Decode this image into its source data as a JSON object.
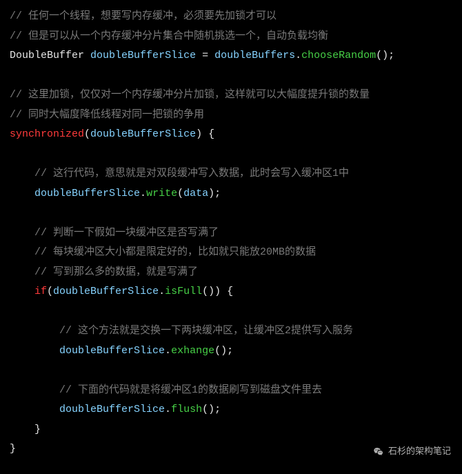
{
  "code": {
    "lines": [
      {
        "type": "comment",
        "text": "// 任何一个线程，想要写内存缓冲，必须要先加锁才可以"
      },
      {
        "type": "comment",
        "text": "// 但是可以从一个内存缓冲分片集合中随机挑选一个，自动负载均衡"
      },
      {
        "type": "decl",
        "typeName": "DoubleBuffer",
        "varName": "doubleBufferSlice",
        "eq": " = ",
        "rhsObj": "doubleBuffers",
        "dot": ".",
        "rhsMethod": "chooseRandom",
        "call": "();"
      },
      {
        "type": "blank"
      },
      {
        "type": "comment",
        "text": "// 这里加锁，仅仅对一个内存缓冲分片加锁，这样就可以大幅度提升锁的数量"
      },
      {
        "type": "comment",
        "text": "// 同时大幅度降低线程对同一把锁的争用"
      },
      {
        "type": "sync",
        "kw": "synchronized",
        "open": "(",
        "arg": "doubleBufferSlice",
        "close": ") {"
      },
      {
        "type": "blank"
      },
      {
        "type": "comment",
        "indent": "    ",
        "text": "// 这行代码，意思就是对双段缓冲写入数据，此时会写入缓冲区1中"
      },
      {
        "type": "call",
        "indent": "    ",
        "obj": "doubleBufferSlice",
        "dot": ".",
        "method": "write",
        "open": "(",
        "arg": "data",
        "close": ");"
      },
      {
        "type": "blank"
      },
      {
        "type": "comment",
        "indent": "    ",
        "text": "// 判断一下假如一块缓冲区是否写满了"
      },
      {
        "type": "comment",
        "indent": "    ",
        "text": "// 每块缓冲区大小都是限定好的，比如就只能放20MB的数据"
      },
      {
        "type": "comment",
        "indent": "    ",
        "text": "// 写到那么多的数据，就是写满了"
      },
      {
        "type": "if",
        "indent": "    ",
        "kw": "if",
        "open": "(",
        "obj": "doubleBufferSlice",
        "dot": ".",
        "method": "isFull",
        "call": "()",
        "close": ") {"
      },
      {
        "type": "blank"
      },
      {
        "type": "comment",
        "indent": "        ",
        "text": "// 这个方法就是交换一下两块缓冲区，让缓冲区2提供写入服务"
      },
      {
        "type": "call",
        "indent": "        ",
        "obj": "doubleBufferSlice",
        "dot": ".",
        "method": "exhange",
        "open": "(",
        "arg": "",
        "close": ");"
      },
      {
        "type": "blank"
      },
      {
        "type": "comment",
        "indent": "        ",
        "text": "// 下面的代码就是将缓冲区1的数据刷写到磁盘文件里去"
      },
      {
        "type": "call",
        "indent": "        ",
        "obj": "doubleBufferSlice",
        "dot": ".",
        "method": "flush",
        "open": "(",
        "arg": "",
        "close": ");"
      },
      {
        "type": "brace",
        "indent": "    ",
        "text": "}"
      },
      {
        "type": "brace",
        "indent": "",
        "text": "}"
      }
    ]
  },
  "watermark": {
    "text": "石杉的架构笔记",
    "icon": "wechat-icon"
  }
}
